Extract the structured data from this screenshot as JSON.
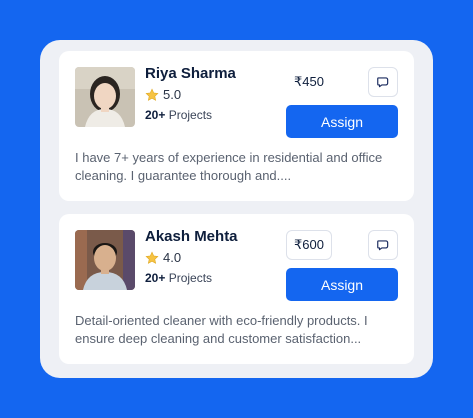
{
  "theme": {
    "accent": "#1466f0",
    "background": "#1466f0",
    "panel": "#eef0f5",
    "star": "#f6c343"
  },
  "cleaners": [
    {
      "name": "Riya Sharma",
      "rating": "5.0",
      "projects_count": "20+",
      "projects_label": "Projects",
      "price": "₹450",
      "assign_label": "Assign",
      "description": "I have 7+ years of experience in residential and office cleaning. I guarantee thorough and....",
      "icons": {
        "rating": "star-icon",
        "chat": "chat-bubble-icon"
      }
    },
    {
      "name": "Akash Mehta",
      "rating": "4.0",
      "projects_count": "20+",
      "projects_label": "Projects",
      "price": "₹600",
      "assign_label": "Assign",
      "description": "Detail-oriented cleaner with eco-friendly products. I ensure deep cleaning and customer satisfaction...",
      "icons": {
        "rating": "star-icon",
        "chat": "chat-bubble-icon"
      }
    }
  ]
}
